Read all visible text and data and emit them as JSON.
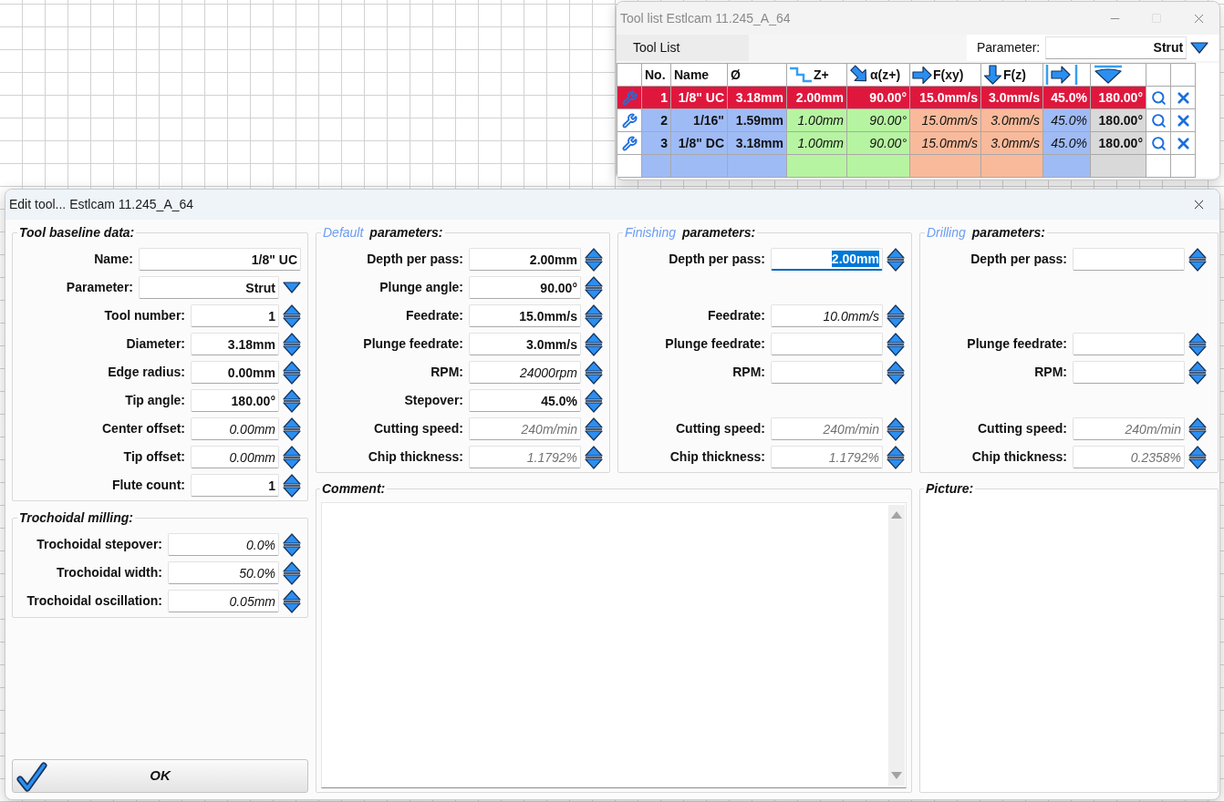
{
  "tool_list_window": {
    "title": "Tool list Estlcam 11.245_A_64",
    "tab": "Tool List",
    "parameter": {
      "label": "Parameter:",
      "value": "Strut"
    },
    "table": {
      "columns": [
        {
          "label": "No.",
          "color": "#9fbbf6"
        },
        {
          "label": "Name",
          "color": "#9fbbf6"
        },
        {
          "label": "Ø",
          "color": "#9fbbf6"
        },
        {
          "label": "Z+",
          "color": "#b7f4a2"
        },
        {
          "label": "α(z+)",
          "color": "#b7f4a2"
        },
        {
          "label": "F(xy)",
          "color": "#f9ba9b"
        },
        {
          "label": "F(z)",
          "color": "#f9ba9b"
        },
        {
          "color": "#9fbbf6"
        },
        {
          "color": "#d9d9d9"
        }
      ],
      "rows": [
        {
          "selected": true,
          "cells": [
            {
              "text": "1",
              "italic": false
            },
            {
              "text": "1/8\" UC",
              "italic": false
            },
            {
              "text": "3.18mm",
              "italic": false
            },
            {
              "text": "2.00mm",
              "italic": false
            },
            {
              "text": "90.00°",
              "italic": false
            },
            {
              "text": "15.0mm/s",
              "italic": false
            },
            {
              "text": "3.0mm/s",
              "italic": false
            },
            {
              "text": "45.0%",
              "italic": false
            },
            {
              "text": "180.00°",
              "italic": false
            }
          ]
        },
        {
          "selected": false,
          "cells": [
            {
              "text": "2",
              "italic": false
            },
            {
              "text": "1/16\"",
              "italic": false
            },
            {
              "text": "1.59mm",
              "italic": false
            },
            {
              "text": "1.00mm",
              "italic": true
            },
            {
              "text": "90.00°",
              "italic": true
            },
            {
              "text": "15.0mm/s",
              "italic": true
            },
            {
              "text": "3.0mm/s",
              "italic": true
            },
            {
              "text": "45.0%",
              "italic": true
            },
            {
              "text": "180.00°",
              "italic": false
            }
          ]
        },
        {
          "selected": false,
          "cells": [
            {
              "text": "3",
              "italic": false
            },
            {
              "text": "1/8\" DC",
              "italic": false
            },
            {
              "text": "3.18mm",
              "italic": false
            },
            {
              "text": "1.00mm",
              "italic": true
            },
            {
              "text": "90.00°",
              "italic": true
            },
            {
              "text": "15.0mm/s",
              "italic": true
            },
            {
              "text": "3.0mm/s",
              "italic": true
            },
            {
              "text": "45.0%",
              "italic": true
            },
            {
              "text": "180.00°",
              "italic": false
            }
          ]
        }
      ]
    }
  },
  "edit_window": {
    "title": "Edit tool... Estlcam 11.245_A_64",
    "baseline": {
      "title": "Tool baseline data:",
      "fields": [
        {
          "kind": "text",
          "label": "Name:",
          "value": "1/8\" UC",
          "italic": false,
          "disabled": false,
          "focused": false
        },
        {
          "kind": "dropdown",
          "label": "Parameter:",
          "value": "Strut",
          "italic": false,
          "disabled": false,
          "focused": false
        },
        {
          "kind": "spin",
          "label": "Tool number:",
          "value": "1",
          "italic": false,
          "disabled": false,
          "focused": false
        },
        {
          "kind": "spin",
          "label": "Diameter:",
          "value": "3.18mm",
          "italic": false,
          "disabled": false,
          "focused": false
        },
        {
          "kind": "spin",
          "label": "Edge radius:",
          "value": "0.00mm",
          "italic": false,
          "disabled": false,
          "focused": false
        },
        {
          "kind": "spin",
          "label": "Tip angle:",
          "value": "180.00°",
          "italic": false,
          "disabled": false,
          "focused": false
        },
        {
          "kind": "spin",
          "label": "Center offset:",
          "value": "0.00mm",
          "italic": true,
          "disabled": false,
          "focused": false
        },
        {
          "kind": "spin",
          "label": "Tip offset:",
          "value": "0.00mm",
          "italic": true,
          "disabled": false,
          "focused": false
        },
        {
          "kind": "spin",
          "label": "Flute count:",
          "value": "1",
          "italic": false,
          "disabled": false,
          "focused": false
        }
      ]
    },
    "trochoidal": {
      "title": "Trochoidal milling:",
      "fields": [
        {
          "kind": "spin",
          "label": "Trochoidal stepover:",
          "value": "0.0%",
          "italic": true,
          "disabled": false,
          "focused": false
        },
        {
          "kind": "spin",
          "label": "Trochoidal width:",
          "value": "50.0%",
          "italic": true,
          "disabled": false,
          "focused": false
        },
        {
          "kind": "spin",
          "label": "Trochoidal oscillation:",
          "value": "0.05mm",
          "italic": true,
          "disabled": false,
          "focused": false
        }
      ]
    },
    "parameter_groups": [
      {
        "accent": "Default",
        "title": "parameters:",
        "fields": [
          {
            "kind": "spin",
            "label": "Depth per pass:",
            "value": "2.00mm",
            "italic": false,
            "disabled": false,
            "focused": false
          },
          {
            "kind": "spin",
            "label": "Plunge angle:",
            "value": "90.00°",
            "italic": false,
            "disabled": false,
            "focused": false
          },
          {
            "kind": "spin",
            "label": "Feedrate:",
            "value": "15.0mm/s",
            "italic": false,
            "disabled": false,
            "focused": false
          },
          {
            "kind": "spin",
            "label": "Plunge feedrate:",
            "value": "3.0mm/s",
            "italic": false,
            "disabled": false,
            "focused": false
          },
          {
            "kind": "spin",
            "label": "RPM:",
            "value": "24000rpm",
            "italic": true,
            "disabled": false,
            "focused": false
          },
          {
            "kind": "spin",
            "label": "Stepover:",
            "value": "45.0%",
            "italic": false,
            "disabled": false,
            "focused": false
          },
          {
            "kind": "spin",
            "label": "Cutting speed:",
            "value": "240m/min",
            "italic": true,
            "disabled": true,
            "focused": false
          },
          {
            "kind": "spin",
            "label": "Chip thickness:",
            "value": "1.1792%",
            "italic": true,
            "disabled": true,
            "focused": false
          }
        ]
      },
      {
        "accent": "Finishing",
        "title": "parameters:",
        "fields": [
          {
            "kind": "spin",
            "label": "Depth per pass:",
            "value": "2.00mm",
            "italic": false,
            "disabled": false,
            "focused": true
          },
          {
            "kind": "spin",
            "label": "Feedrate:",
            "value": "10.0mm/s",
            "italic": true,
            "disabled": false,
            "focused": false
          },
          {
            "kind": "spin",
            "label": "Plunge feedrate:",
            "focused": false
          },
          {
            "kind": "spin",
            "label": "RPM:",
            "focused": false
          },
          {
            "kind": "spin",
            "label": "Cutting speed:",
            "value": "240m/min",
            "italic": true,
            "disabled": true,
            "focused": false
          },
          {
            "kind": "spin",
            "label": "Chip thickness:",
            "value": "1.1792%",
            "italic": true,
            "disabled": true,
            "focused": false
          }
        ]
      },
      {
        "accent": "Drilling",
        "title": "parameters:",
        "fields": [
          {
            "kind": "spin",
            "label": "Depth per pass:",
            "focused": false
          },
          {
            "kind": "spin",
            "label": "Plunge feedrate:",
            "focused": false
          },
          {
            "kind": "spin",
            "label": "RPM:",
            "focused": false
          },
          {
            "kind": "spin",
            "label": "Cutting speed:",
            "value": "240m/min",
            "italic": true,
            "disabled": true,
            "focused": false
          },
          {
            "kind": "spin",
            "label": "Chip thickness:",
            "value": "0.2358%",
            "italic": true,
            "disabled": true,
            "focused": false
          }
        ]
      }
    ],
    "comment": {
      "title": "Comment:"
    },
    "picture": {
      "title": "Picture:"
    },
    "ok_button": {
      "label": "OK"
    }
  }
}
